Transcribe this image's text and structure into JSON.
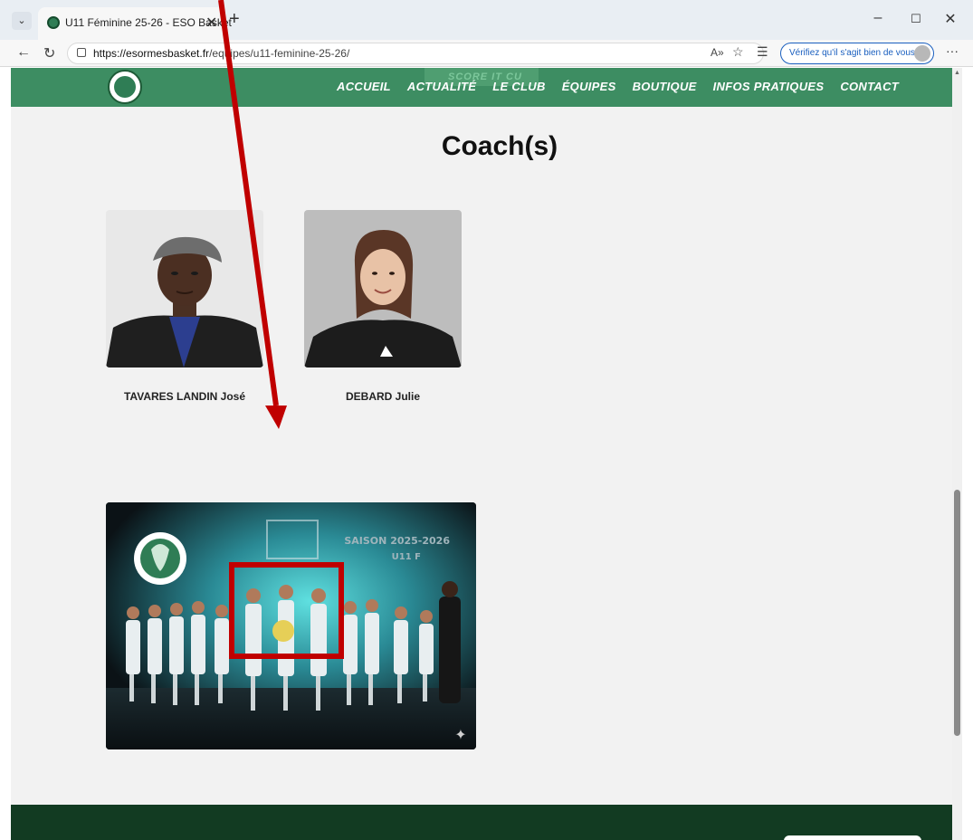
{
  "browser": {
    "tab_title": "U11 Féminine 25-26 - ESO Basket",
    "tab_close": "✕",
    "new_tab": "+",
    "url_host": "https://esormesbasket.fr",
    "url_path": "/equipes/u11-feminine-25-26/",
    "verify_label": "Vérifiez qu'il s'agit bien de vous",
    "window_controls": {
      "minimize": "–",
      "maximize": "☐",
      "close": "✕"
    }
  },
  "site": {
    "promo_text": "SCORE IT CU",
    "menu": [
      {
        "label": "ACCUEIL"
      },
      {
        "label": "ACTUALITÉ"
      },
      {
        "label": "LE CLUB"
      },
      {
        "label": "ÉQUIPES"
      },
      {
        "label": "BOUTIQUE"
      },
      {
        "label": "INFOS PRATIQUES"
      },
      {
        "label": "CONTACT"
      }
    ]
  },
  "main": {
    "heading": "Coach(s)",
    "coaches": [
      {
        "name": "TAVARES LANDIN José"
      },
      {
        "name": "DEBARD Julie"
      }
    ],
    "team_photo": {
      "season_line1": "SAISON 2025-2026",
      "season_line2": "U11 F"
    }
  },
  "annotations": {
    "arrow_color": "#c00000",
    "box_color": "#c00000"
  },
  "colors": {
    "nav_green": "#3d8d62",
    "footer_green": "#123b22",
    "page_bg": "#f2f2f2"
  }
}
